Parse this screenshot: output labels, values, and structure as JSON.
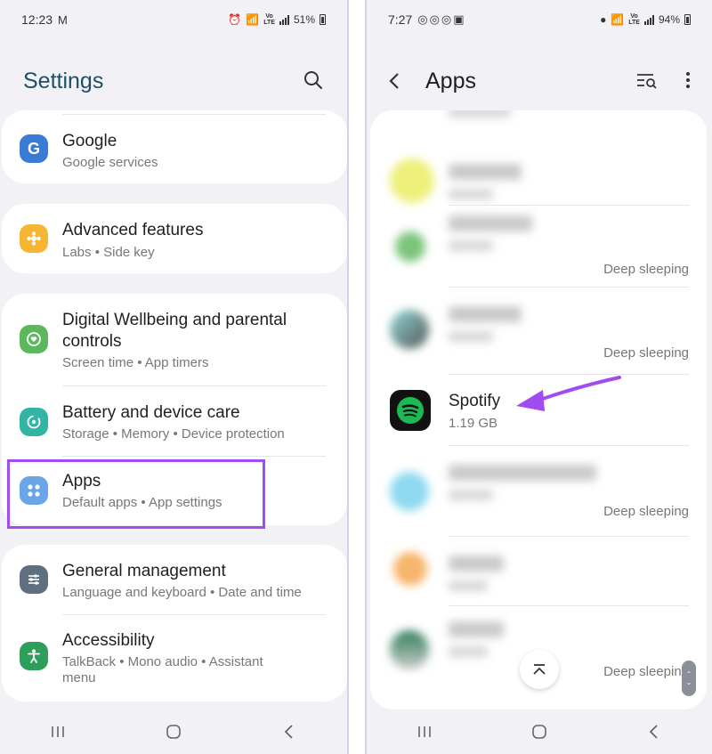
{
  "left": {
    "status": {
      "time": "12:23",
      "left_icons": "M",
      "network": "VoLTE LTE1",
      "battery": "51%"
    },
    "header": {
      "title": "Settings"
    },
    "items": [
      {
        "title": "Google",
        "subtitle": "Google services",
        "icon": "google-icon",
        "color": "#3a7bd5"
      },
      {
        "title": "Advanced features",
        "subtitle": "Labs  •  Side key",
        "icon": "puzzle-icon",
        "color": "#f6b533"
      },
      {
        "title": "Digital Wellbeing and parental",
        "title2": "controls",
        "subtitle": "Screen time  •  App timers",
        "icon": "wellbeing-icon",
        "color": "#5cb85c"
      },
      {
        "title": "Battery and device care",
        "subtitle": "Storage  •  Memory  •  Device protection",
        "icon": "device-care-icon",
        "color": "#33b5a5"
      },
      {
        "title": "Apps",
        "subtitle": "Default apps  •  App settings",
        "icon": "apps-grid-icon",
        "color": "#6aa5e8"
      },
      {
        "title": "General management",
        "subtitle": "Language and keyboard  •  Date and time",
        "icon": "sliders-icon",
        "color": "#5f6f80"
      },
      {
        "title": "Accessibility",
        "subtitle": "TalkBack  •  Mono audio  •  Assistant",
        "subtitle2": "menu",
        "icon": "accessibility-icon",
        "color": "#2e9e5b"
      }
    ]
  },
  "right": {
    "status": {
      "time": "7:27",
      "network": "VoLTE LTE1",
      "battery": "94%"
    },
    "header": {
      "title": "Apps"
    },
    "spotify": {
      "title": "Spotify",
      "size": "1.19 GB"
    },
    "deep_sleeping": "Deep sleeping"
  },
  "colors": {
    "highlight": "#a04cf0",
    "arrow": "#a04cf0",
    "spotify_green": "#1db954"
  }
}
